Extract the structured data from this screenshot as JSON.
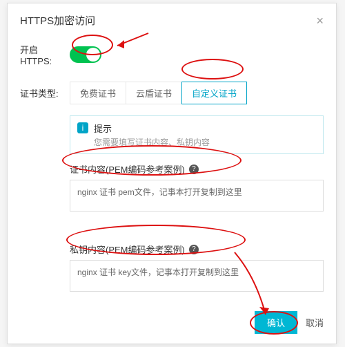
{
  "dialog": {
    "title": "HTTPS加密访问",
    "close_glyph": "×"
  },
  "enable": {
    "label": "开启HTTPS:",
    "on": true
  },
  "cert_type": {
    "label": "证书类型:",
    "tabs": [
      "免费证书",
      "云盾证书",
      "自定义证书"
    ],
    "active_index": 2
  },
  "hint": {
    "icon": "i",
    "title": "提示",
    "sub": "您需要填写证书内容、私钥内容"
  },
  "cert_content": {
    "label": "证书内容(PEM编码参考案例)",
    "help_glyph": "?",
    "value": "nginx 证书 pem文件，记事本打开复制到这里"
  },
  "key_content": {
    "label": "私钥内容(PEM编码参考案例)",
    "help_glyph": "?",
    "value": "nginx 证书 key文件，记事本打开复制到这里"
  },
  "footer": {
    "confirm": "确认",
    "cancel": "取消"
  }
}
